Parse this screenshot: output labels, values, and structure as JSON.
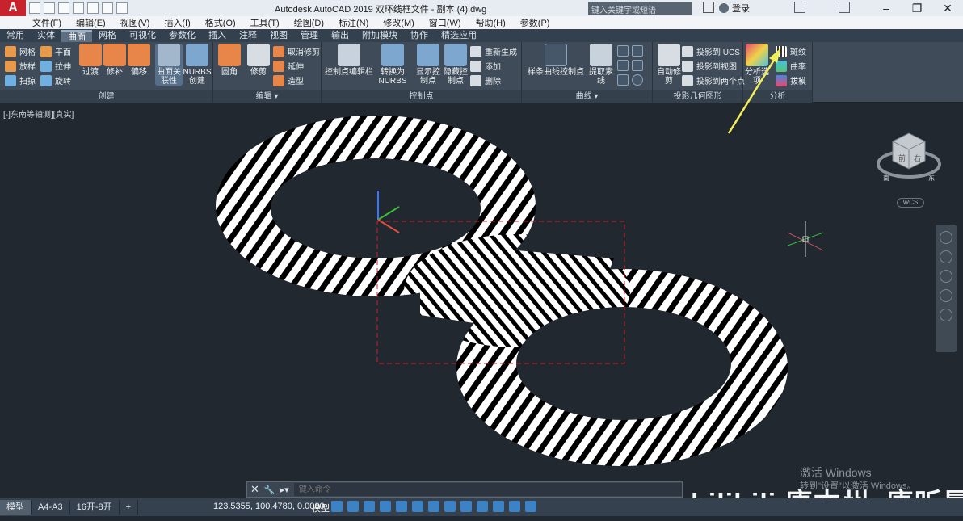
{
  "titlebar": {
    "app_logo": "A",
    "title": "Autodesk AutoCAD 2019   双环线框文件 - 副本 (4).dwg",
    "search_placeholder": "键入关键字或短语",
    "login": "登录"
  },
  "menubar": [
    "文件(F)",
    "编辑(E)",
    "视图(V)",
    "插入(I)",
    "格式(O)",
    "工具(T)",
    "绘图(D)",
    "标注(N)",
    "修改(M)",
    "窗口(W)",
    "帮助(H)",
    "参数(P)"
  ],
  "tabs": [
    "常用",
    "实体",
    "曲面",
    "网格",
    "可视化",
    "参数化",
    "插入",
    "注释",
    "视图",
    "管理",
    "输出",
    "附加模块",
    "协作",
    "精选应用"
  ],
  "active_tab": "曲面",
  "ribbon": {
    "create": {
      "title": "创建",
      "items": [
        "网格",
        "放样",
        "扫掠",
        "平面",
        "拉伸",
        "旋转",
        "过渡",
        "修补",
        "偏移",
        "曲面关联性",
        "NURBS创建"
      ]
    },
    "edit": {
      "title": "编辑",
      "items": [
        "圆角",
        "修剪",
        "取消修剪",
        "延伸",
        "造型"
      ]
    },
    "controlpoints": {
      "title": "控制点",
      "items": [
        "控制点编辑栏",
        "转换为NURBS",
        "显示控制点",
        "隐藏控制点",
        "重新生成",
        "添加",
        "删除"
      ]
    },
    "curves": {
      "title": "曲线",
      "items": [
        "样条曲线控制点",
        "提取素线"
      ]
    },
    "projection": {
      "title": "投影几何图形",
      "items": [
        "自动修剪",
        "投影到 UCS",
        "投影到视图",
        "投影到两个点"
      ]
    },
    "analysis": {
      "title": "分析",
      "items": [
        "分析选项",
        "斑纹",
        "曲率",
        "拔模"
      ]
    }
  },
  "viewport": {
    "label": "[-]东南等轴测][真实]",
    "viewcube_faces": [
      "前",
      "右",
      "南",
      "东"
    ],
    "wcs": "WCS"
  },
  "command": {
    "placeholder": "键入命令"
  },
  "status": {
    "tabs": [
      "模型",
      "A4-A3",
      "16开-8开",
      "+"
    ],
    "coords": "123.5355, 100.4780, 0.0000",
    "mode": "模型"
  },
  "watermark": {
    "line1": "激活 Windows",
    "line2": "转到\"设置\"以激活 Windows。",
    "bili": "bilibili 唐本州_唐昕晨"
  },
  "colors": {
    "accent": "#3d82c2",
    "arrow": "#f2f05a",
    "viewport_bg": "#212830"
  }
}
